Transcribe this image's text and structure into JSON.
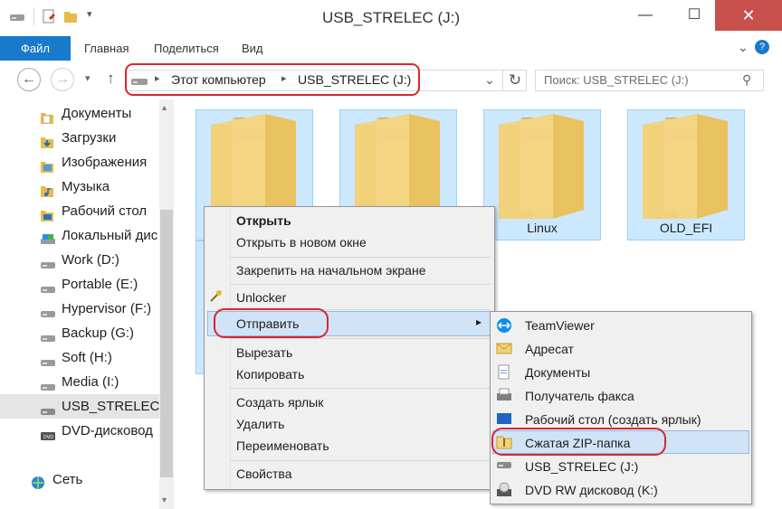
{
  "window": {
    "title": "USB_STRELEC (J:)",
    "minimize_glyph": "—",
    "maximize_glyph": "☐",
    "close_glyph": "✕"
  },
  "ribbon": {
    "tabs": [
      "Файл",
      "Главная",
      "Поделиться",
      "Вид"
    ],
    "collapse_glyph": "⌄",
    "help_glyph": "?"
  },
  "nav": {
    "back": "←",
    "forward": "→",
    "recent": "▾",
    "up": "↑",
    "separator": "▸",
    "breadcrumb": [
      "Этот компьютер",
      "USB_STRELEC (J:)"
    ],
    "addr_dropdown": "⌄",
    "refresh": "↻",
    "search_placeholder": "Поиск: USB_STRELEC (J:)",
    "search_glyph": "⚲"
  },
  "sidebar": {
    "items": [
      {
        "label": "Документы",
        "icon": "documents-icon"
      },
      {
        "label": "Загрузки",
        "icon": "downloads-icon"
      },
      {
        "label": "Изображения",
        "icon": "pictures-icon"
      },
      {
        "label": "Музыка",
        "icon": "music-icon"
      },
      {
        "label": "Рабочий стол",
        "icon": "desktop-icon"
      },
      {
        "label": "Локальный дис",
        "icon": "local-disk-icon"
      },
      {
        "label": "Work (D:)",
        "icon": "drive-icon"
      },
      {
        "label": "Portable (E:)",
        "icon": "drive-icon"
      },
      {
        "label": "Hypervisor (F:)",
        "icon": "drive-icon"
      },
      {
        "label": "Backup (G:)",
        "icon": "drive-icon"
      },
      {
        "label": "Soft (H:)",
        "icon": "drive-icon"
      },
      {
        "label": "Media (I:)",
        "icon": "drive-icon"
      },
      {
        "label": "USB_STRELEC (J",
        "icon": "usb-drive-icon"
      },
      {
        "label": "DVD-дисковод",
        "icon": "dvd-drive-icon"
      },
      {
        "label": "Сеть",
        "icon": "network-icon"
      }
    ],
    "scroll_up": "▴",
    "scroll_down": "▾"
  },
  "folders": [
    "",
    "",
    "Linux",
    "OLD_EFI"
  ],
  "context_menu": {
    "open": "Открыть",
    "open_new_window": "Открыть в новом окне",
    "pin_start": "Закрепить на начальном экране",
    "unlocker": "Unlocker",
    "send_to": "Отправить",
    "send_arrow": "▸",
    "cut": "Вырезать",
    "copy": "Копировать",
    "create_shortcut": "Создать ярлык",
    "delete": "Удалить",
    "rename": "Переименовать",
    "properties": "Свойства"
  },
  "send_to_menu": {
    "items": [
      {
        "label": "TeamViewer",
        "icon": "teamviewer-icon"
      },
      {
        "label": "Адресат",
        "icon": "mail-recipient-icon"
      },
      {
        "label": "Документы",
        "icon": "documents-icon"
      },
      {
        "label": "Получатель факса",
        "icon": "fax-icon"
      },
      {
        "label": "Рабочий стол (создать ярлык)",
        "icon": "desktop-shortcut-icon"
      },
      {
        "label": "Сжатая ZIP-папка",
        "icon": "zip-folder-icon"
      },
      {
        "label": "USB_STRELEC (J:)",
        "icon": "usb-drive-icon"
      },
      {
        "label": "DVD RW дисковод (K:)",
        "icon": "dvd-drive-icon"
      }
    ]
  },
  "colors": {
    "accent": "#1979ca",
    "selection": "#cce8ff",
    "annotation": "#d8272d",
    "folder": "#f3d37d"
  }
}
